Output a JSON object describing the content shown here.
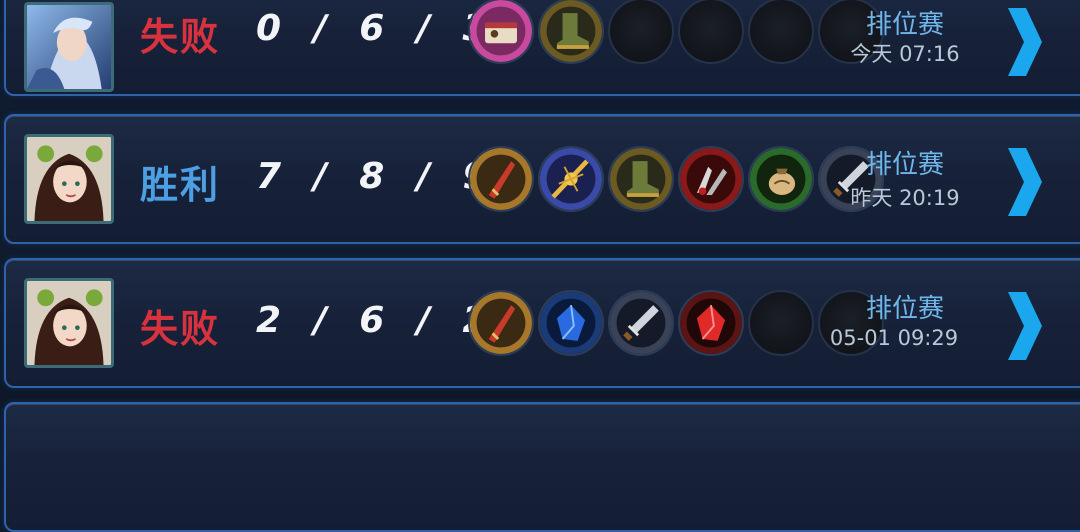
{
  "matches": [
    {
      "result": "失败",
      "result_type": "lose",
      "kda": "0 / 6 / 3",
      "mode": "排位赛",
      "time": "今天 07:16",
      "items": [
        "scroll-book-icon",
        "boots-icon",
        "empty",
        "empty",
        "empty",
        "empty"
      ]
    },
    {
      "result": "胜利",
      "result_type": "win",
      "kda": "7 / 8 / 9",
      "mode": "排位赛",
      "time": "昨天 20:19",
      "items": [
        "crimson-blade-icon",
        "golden-spear-icon",
        "boots-icon",
        "red-claw-icon",
        "green-pouch-icon",
        "dagger-icon"
      ]
    },
    {
      "result": "失败",
      "result_type": "lose",
      "kda": "2 / 6 / 2",
      "mode": "排位赛",
      "time": "05-01  09:29",
      "items": [
        "crimson-blade-icon",
        "blue-crystal-icon",
        "dagger-icon",
        "red-crystal-icon",
        "empty",
        "empty"
      ]
    }
  ],
  "colors": {
    "lose": "#d8323f",
    "win": "#4d9fe4",
    "mode": "#6fb6ea",
    "border": "#2f63a8",
    "chevron": "#1aa7ee"
  }
}
